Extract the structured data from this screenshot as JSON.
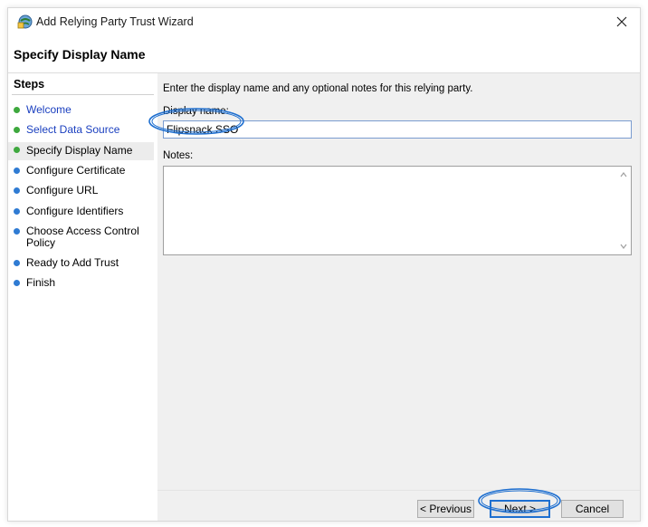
{
  "window": {
    "title": "Add Relying Party Trust Wizard",
    "page_heading": "Specify Display Name"
  },
  "steps": {
    "title": "Steps",
    "items": [
      {
        "label": "Welcome",
        "state": "done"
      },
      {
        "label": "Select Data Source",
        "state": "done"
      },
      {
        "label": "Specify Display Name",
        "state": "current"
      },
      {
        "label": "Configure Certificate",
        "state": "pending"
      },
      {
        "label": "Configure URL",
        "state": "pending"
      },
      {
        "label": "Configure Identifiers",
        "state": "pending"
      },
      {
        "label": "Choose Access Control Policy",
        "state": "pending"
      },
      {
        "label": "Ready to Add Trust",
        "state": "pending"
      },
      {
        "label": "Finish",
        "state": "pending"
      }
    ]
  },
  "form": {
    "instruction": "Enter the display name and any optional notes for this relying party.",
    "display_name_label": "Display name:",
    "display_name_value": "Flipsnack SSO",
    "notes_label": "Notes:",
    "notes_value": ""
  },
  "buttons": {
    "previous": "< Previous",
    "next": "Next >",
    "cancel": "Cancel"
  },
  "colors": {
    "done_dot": "#3ea83e",
    "pending_dot": "#2f7bd3",
    "link_text": "#1a3fbf",
    "annotation": "#1e6fd0"
  },
  "icons": {
    "title_icon": "wizard-icon",
    "close": "close-icon"
  }
}
